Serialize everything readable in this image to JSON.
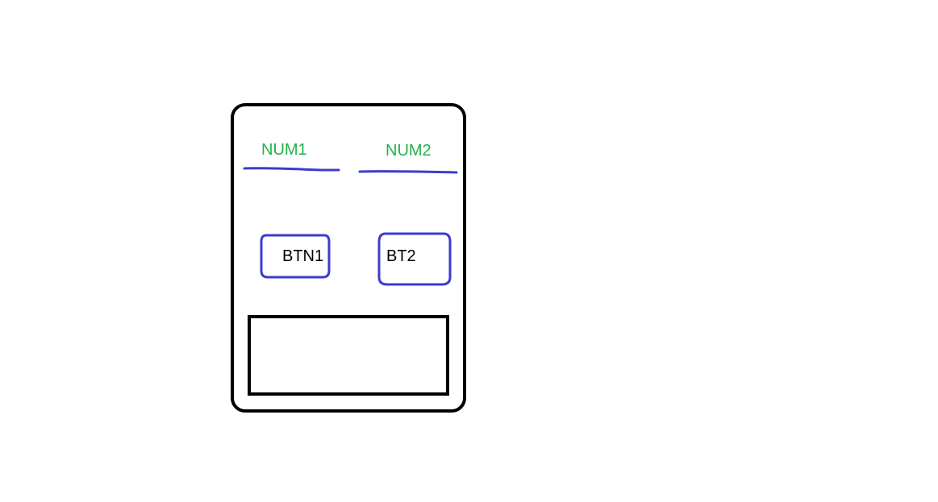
{
  "mockup": {
    "fields": [
      {
        "label": "NUM1",
        "underline_color": "#3c3ccc"
      },
      {
        "label": "NUM2",
        "underline_color": "#3c3ccc"
      }
    ],
    "buttons": [
      {
        "label": "BTN1",
        "outline_color": "#3c3ccc"
      },
      {
        "label": "BT2",
        "outline_color": "#3c3ccc"
      }
    ],
    "colors": {
      "label_text": "#22b14c",
      "button_text": "#000000",
      "frame": "#000000",
      "output_box": "#000000",
      "background": "#ffffff"
    }
  }
}
